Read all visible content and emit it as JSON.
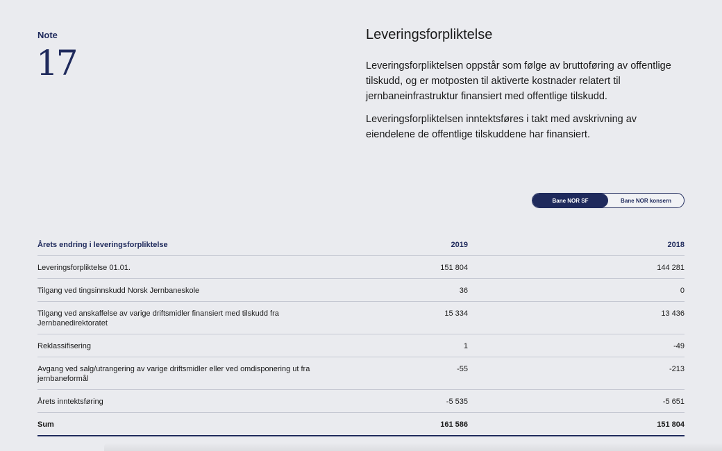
{
  "note": {
    "label": "Note",
    "number": "17"
  },
  "section": {
    "title": "Leveringsforpliktelse",
    "paragraphs": [
      "Leveringsforpliktelsen oppstår som følge av bruttoføring av offentlige tilskudd, og er motposten til aktiverte kostnader relatert til jernbaneinfrastruktur finansiert med offentlige tilskudd.",
      "Leveringsforpliktelsen inntektsføres i takt med avskrivning av eiendelene de offentlige tilskuddene har finansiert."
    ]
  },
  "toggle": {
    "options": [
      "Bane NOR SF",
      "Bane NOR konsern"
    ],
    "selected": "Bane NOR SF"
  },
  "table": {
    "header": {
      "label": "Årets endring i leveringsforpliktelse",
      "y2019": "2019",
      "y2018": "2018"
    },
    "rows": [
      {
        "label": "Leveringsforpliktelse 01.01.",
        "y2019": "151 804",
        "y2018": "144 281"
      },
      {
        "label": "Tilgang ved tingsinnskudd Norsk Jernbaneskole",
        "y2019": "36",
        "y2018": "0"
      },
      {
        "label": "Tilgang ved anskaffelse av varige driftsmidler finansiert med tilskudd fra Jernbanedirektoratet",
        "y2019": "15 334",
        "y2018": "13 436"
      },
      {
        "label": "Reklassifisering",
        "y2019": "1",
        "y2018": "-49"
      },
      {
        "label": "Avgang ved salg/utrangering av varige driftsmidler eller ved omdisponering ut fra jernbaneformål",
        "y2019": "-55",
        "y2018": "-213"
      },
      {
        "label": "Årets inntektsføring",
        "y2019": "-5 535",
        "y2018": "-5 651"
      }
    ],
    "sum": {
      "label": "Sum",
      "y2019": "161 586",
      "y2018": "151 804"
    }
  }
}
